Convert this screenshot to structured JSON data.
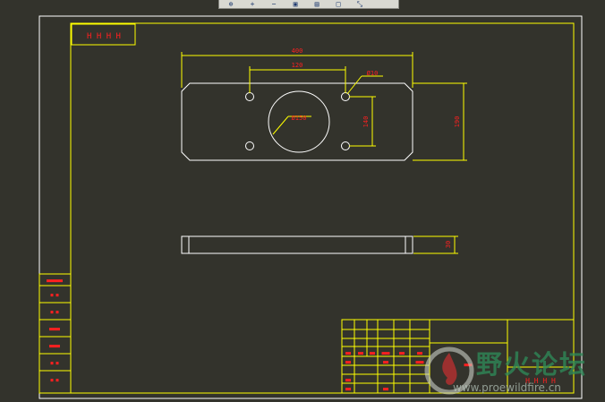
{
  "toolbar": {
    "buttons": [
      {
        "icon": "zoom-window-icon",
        "glyph": "⊕"
      },
      {
        "icon": "zoom-in-icon",
        "glyph": "+"
      },
      {
        "icon": "zoom-out-icon",
        "glyph": "−"
      },
      {
        "icon": "zoom-extents-icon",
        "glyph": "▣"
      },
      {
        "icon": "pan-icon",
        "glyph": "▤"
      },
      {
        "icon": "redraw-icon",
        "glyph": "□"
      },
      {
        "icon": "measure-icon",
        "glyph": "⤡"
      }
    ]
  },
  "drawing": {
    "title_tag": "H H H H",
    "dims": {
      "overall_width": "400",
      "hole_spacing": "120",
      "small_hole_dia": "Ø10",
      "center_hole_dia": "Ø150",
      "hole_v_spacing": "140",
      "overall_height": "190",
      "thickness": "30"
    },
    "side_table_labels": [
      "■■■■■■",
      "■ ■",
      "■ ■",
      "■■■■",
      "■■■■",
      "■ ■",
      "■ ■"
    ],
    "title_block": {
      "cells_row1": [
        "■■",
        "■■",
        "■■",
        "■■■",
        "■■",
        "■■"
      ],
      "cells_row2": [
        "■■",
        "■■",
        "■■■",
        "■■",
        "■■"
      ],
      "cells_row3": [
        "■■",
        "■■",
        "■■"
      ],
      "part_name": "H H H H",
      "scale": "■■■"
    }
  },
  "watermark": {
    "chinese": "野火论坛",
    "url": "www.proewildfire.cn"
  },
  "colors": {
    "background": "#33332c",
    "border": "#ffffff",
    "frame": "#ffff00",
    "text": "#ff2020",
    "dimension": "#ffff00",
    "geometry": "#ffffff"
  }
}
